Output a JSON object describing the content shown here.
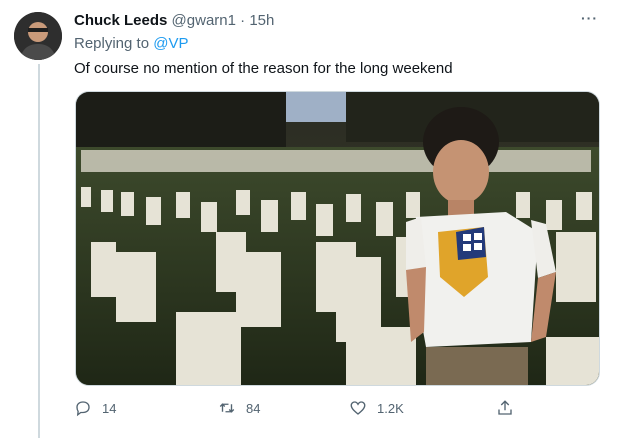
{
  "tweet": {
    "author_name": "Chuck Leeds",
    "handle": "@gwarn1",
    "separator": "·",
    "time": "15h",
    "replying_label": "Replying to",
    "replying_mention": "@VP",
    "text": "Of course no mention of the reason for the long weekend",
    "more_label": "···"
  },
  "actions": {
    "reply_count": "14",
    "retweet_count": "84",
    "like_count": "1.2K"
  },
  "icons": [
    "more-icon",
    "reply-icon",
    "retweet-icon",
    "like-icon",
    "share-icon"
  ],
  "colors": {
    "link": "#1d9bf0",
    "muted": "#536471",
    "text": "#0f1419"
  }
}
